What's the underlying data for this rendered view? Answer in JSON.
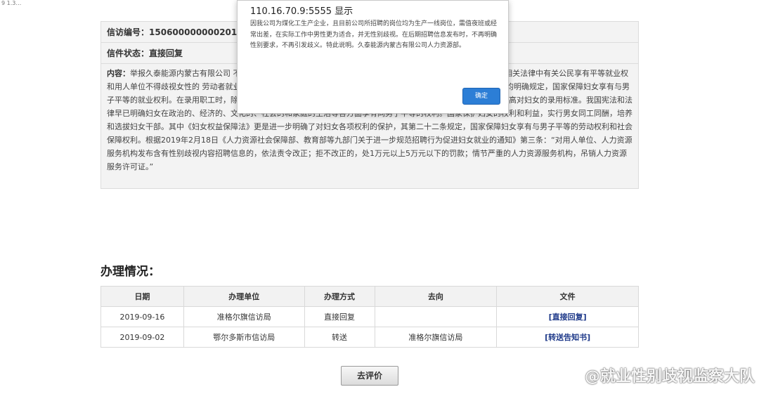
{
  "browser": {
    "url_fragment": "9 1.3…"
  },
  "letter": {
    "number_label": "信访编号：",
    "number_value": "1506000000002019W0",
    "status_label": "信件状态：",
    "status_value": "直接回复",
    "content_label": "内容：",
    "content_text": "举报久泰能源内蒙古有限公司                                                                                  不考虑女性。 （链接https://mp.weixin.qq.com/s/ZLighypAyKTzdm                                                                                  宪法和相关法律中有关公民享有平等就业权和用人单位不得歧视女性的                                                                                  劳动者就业，不因民族、种族、性别、宗教信仰不同而受歧视；其中                                                                                  管理规定》第十六条均明确规定，国家保障妇女享有与男子平等的就业权利。在录用职工时，除国家规定的不适合妇女的工种或者岗位外，不得以性别为由拒绝录用妇女或者提高对妇女的录用标准。我国宪法和法律早已明确妇女在政治的、经济的、文化的、社会的和家庭的生活等各方面享有同男子平等的权利。国家保护妇女的权利和利益，实行男女同工同酬，培养和选拔妇女干部。其中《妇女权益保障法》更是进一步明确了对妇女各项权利的保护，其第二十二条规定，国家保障妇女享有与男子平等的劳动权利和社会保障权利。根据2019年2月18日《人力资源社会保障部、教育部等九部门关于进一步规范招聘行为促进妇女就业的通知》第三条：“对用人单位、人力资源服务机构发布含有性别歧视内容招聘信息的，依法责令改正；拒不改正的，处1万元以上5万元以下的罚款；情节严重的人力资源服务机构，吊销人力资源服务许可证。”"
  },
  "handling": {
    "title": "办理情况：",
    "columns": [
      "日期",
      "办理单位",
      "办理方式",
      "去向",
      "文件"
    ],
    "rows": [
      {
        "date": "2019-09-16",
        "unit": "准格尔旗信访局",
        "method": "直接回复",
        "direction": "",
        "file": "[直接回复]"
      },
      {
        "date": "2019-09-02",
        "unit": "鄂尔多斯市信访局",
        "method": "转送",
        "direction": "准格尔旗信访局",
        "file": "[转送告知书]"
      }
    ]
  },
  "evaluate_button": "去评价",
  "watermark": {
    "text": "@就业性别歧视监察大队",
    "icon": "weibo-icon"
  },
  "dialog": {
    "title": "110.16.70.9:5555 显示",
    "message": "因我公司为煤化工生产企业，且目前公司所招聘的岗位均为生产一线岗位，需值夜班或经常出差，在实际工作中男性更为适合，并无性别歧视。在后期招聘信息发布时，不再明确性别要求，不再引发歧义。特此说明。久泰能源内蒙古有限公司人力资源部。",
    "ok_label": "确定"
  }
}
